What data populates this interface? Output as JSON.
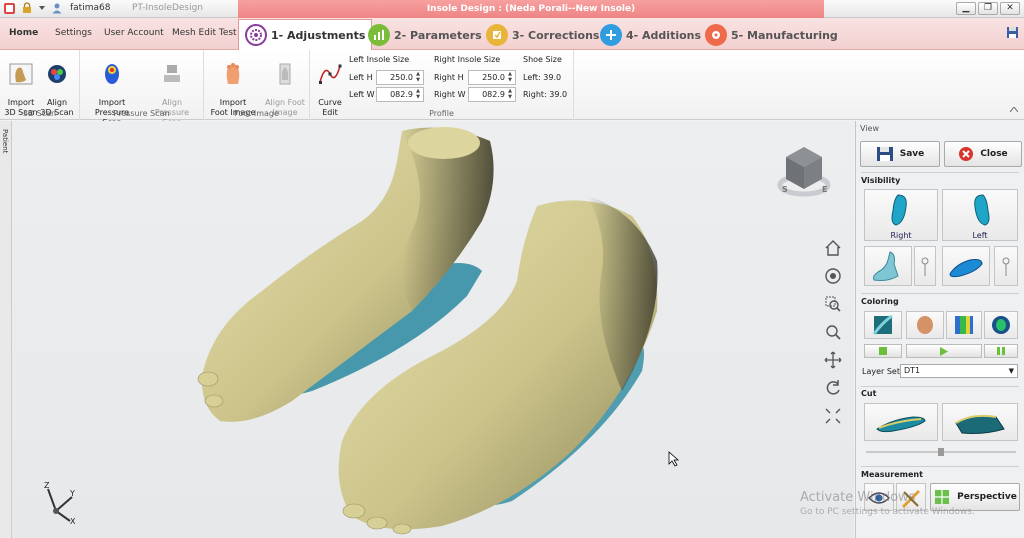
{
  "titlebar": {
    "user": "fatima68",
    "app_name": "PT-InsoleDesign",
    "context_title": "Insole Design : (Neda Porali--New Insole)",
    "win_min": "▁",
    "win_max": "❐",
    "win_close": "✕"
  },
  "menu": {
    "home": "Home",
    "settings": "Settings",
    "user_account": "User Account",
    "mesh_edit_test": "Mesh Edit Test"
  },
  "steps": [
    {
      "label": "1- Adjustments",
      "color": "#8a3a9a"
    },
    {
      "label": "2- Parameters",
      "color": "#7bbd3a"
    },
    {
      "label": "3- Corrections",
      "color": "#e8b43a"
    },
    {
      "label": "4- Additions",
      "color": "#2f9de0"
    },
    {
      "label": "5- Manufacturing",
      "color": "#ef6a4a"
    }
  ],
  "ribbon": {
    "import_3d_scan": "Import\n3D Scan",
    "align_3d_scan": "Align\n3D Scan",
    "group_3d_scan": "3D Scan",
    "import_pressure_scan": "Import\nPressure Scan",
    "align_pressure_scan": "Align\nPressure Scan",
    "group_pressure_scan": "Pressure Scan",
    "import_foot_image": "Import\nFoot Image",
    "align_foot_image": "Align Foot\nImage",
    "group_foot_image": "Foot Image",
    "curve_edit": "Curve\nEdit",
    "left_insole_size": "Left Insole Size",
    "left_h_label": "Left H",
    "left_h_value": "250.0",
    "left_w_label": "Left W",
    "left_w_value": "082.9",
    "right_insole_size": "Right Insole Size",
    "right_h_label": "Right H",
    "right_h_value": "250.0",
    "right_w_label": "Right W",
    "right_w_value": "082.9",
    "shoe_size": "Shoe Size",
    "shoe_left": "Left:  39.0",
    "shoe_right": "Right:  39.0",
    "group_profile": "Profile"
  },
  "left_strip": "Patient",
  "viewcube": {
    "s": "S",
    "e": "E"
  },
  "axis": {
    "x": "X",
    "y": "Y",
    "z": "Z"
  },
  "panel": {
    "title": "View",
    "save": "Save",
    "close": "Close",
    "visibility": "Visibility",
    "vis_right": "Right",
    "vis_left": "Left",
    "coloring": "Coloring",
    "layer_set_label": "Layer Set",
    "layer_set_value": "DT1",
    "cut": "Cut",
    "measurement": "Measurement",
    "perspective": "Perspective"
  },
  "watermark": {
    "line1": "Activate Windows",
    "line2": "Go to PC settings to activate Windows."
  },
  "colors": {
    "foot": "#d8d19a",
    "insole": "#2a8aa0",
    "accent": "#ee8585"
  }
}
